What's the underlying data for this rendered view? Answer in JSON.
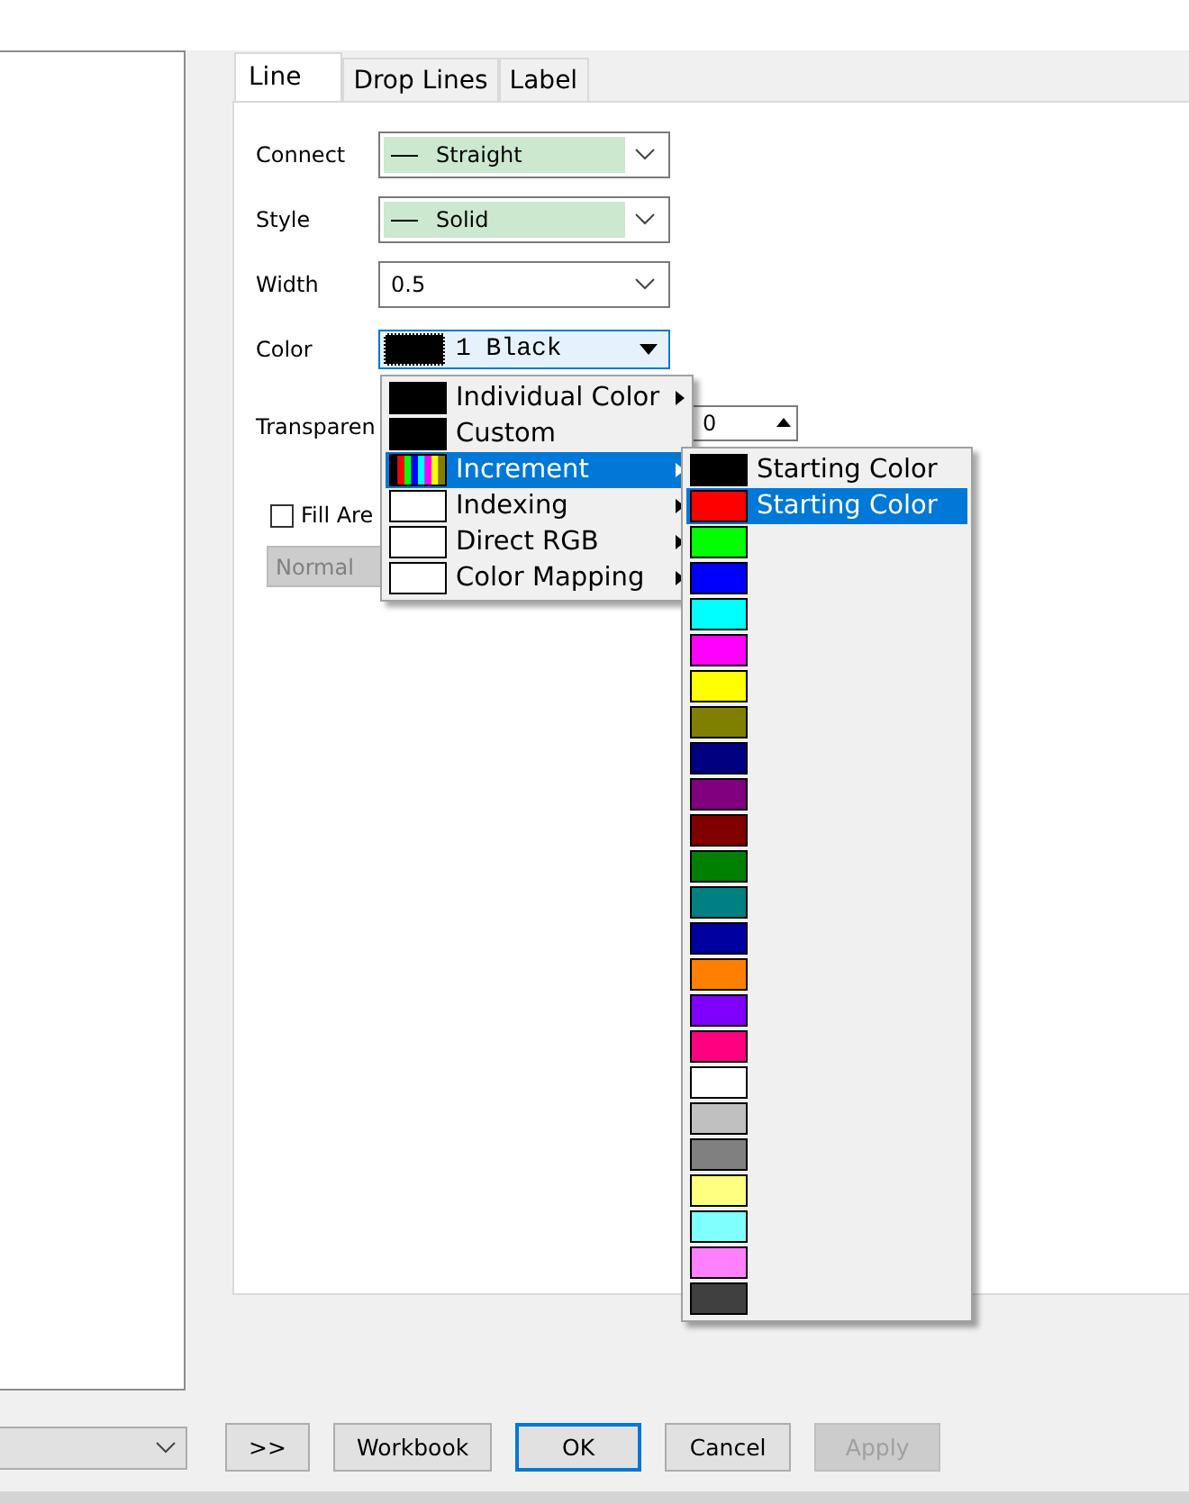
{
  "tabs": [
    {
      "label": "Line",
      "selected": true
    },
    {
      "label": "Drop Lines",
      "selected": false
    },
    {
      "label": "Label",
      "selected": false
    }
  ],
  "fields": [
    {
      "kind": "combo",
      "label": "Connect",
      "value": "Straight",
      "line_icon": true
    },
    {
      "kind": "combo",
      "label": "Style",
      "value": "Solid",
      "line_icon": true
    },
    {
      "kind": "combo",
      "label": "Width",
      "value": "0.5",
      "line_icon": false
    },
    {
      "kind": "color",
      "label": "Color",
      "value": "1 Black",
      "color": "#000000"
    }
  ],
  "transparency": {
    "label": "Transparen",
    "value": "0"
  },
  "fill_area": {
    "label": "Fill Are",
    "checked": false
  },
  "blend_field": {
    "value": "Normal",
    "disabled": true
  },
  "color_menu": [
    {
      "label": "Individual Color",
      "kind": "solid",
      "color": "#000000",
      "submenu": true,
      "selected": false
    },
    {
      "label": "Custom",
      "kind": "solid",
      "color": "#000000",
      "submenu": false,
      "selected": false
    },
    {
      "label": "Increment",
      "kind": "multi",
      "submenu": true,
      "selected": true
    },
    {
      "label": "Indexing",
      "kind": "empty",
      "submenu": true,
      "selected": false
    },
    {
      "label": "Direct RGB",
      "kind": "empty",
      "submenu": true,
      "selected": false
    },
    {
      "label": "Color Mapping",
      "kind": "empty",
      "submenu": true,
      "selected": false
    }
  ],
  "increment_menu": [
    {
      "color": "#000000",
      "label": "Starting Color",
      "selected": false
    },
    {
      "color": "#ff0000",
      "label": "Starting Color",
      "selected": true
    },
    {
      "color": "#00ff00",
      "selected": false
    },
    {
      "color": "#0000ff",
      "selected": false
    },
    {
      "color": "#00ffff",
      "selected": false
    },
    {
      "color": "#ff00ff",
      "selected": false
    },
    {
      "color": "#ffff00",
      "selected": false
    },
    {
      "color": "#808000",
      "selected": false
    },
    {
      "color": "#000080",
      "selected": false
    },
    {
      "color": "#800080",
      "selected": false
    },
    {
      "color": "#800000",
      "selected": false
    },
    {
      "color": "#008000",
      "selected": false
    },
    {
      "color": "#008080",
      "selected": false
    },
    {
      "color": "#0000a0",
      "selected": false
    },
    {
      "color": "#ff8000",
      "selected": false
    },
    {
      "color": "#8000ff",
      "selected": false
    },
    {
      "color": "#ff0080",
      "selected": false
    },
    {
      "color": "#ffffff",
      "selected": false
    },
    {
      "color": "#c0c0c0",
      "selected": false
    },
    {
      "color": "#808080",
      "selected": false
    },
    {
      "color": "#ffff80",
      "selected": false
    },
    {
      "color": "#80ffff",
      "selected": false
    },
    {
      "color": "#ff80ff",
      "selected": false
    },
    {
      "color": "#404040",
      "selected": false
    }
  ],
  "buttons": [
    {
      "label": ">>",
      "kind": "normal"
    },
    {
      "label": "Workbook",
      "kind": "normal"
    },
    {
      "label": "OK",
      "kind": "default"
    },
    {
      "label": "Cancel",
      "kind": "normal"
    },
    {
      "label": "Apply",
      "kind": "disabled"
    }
  ]
}
